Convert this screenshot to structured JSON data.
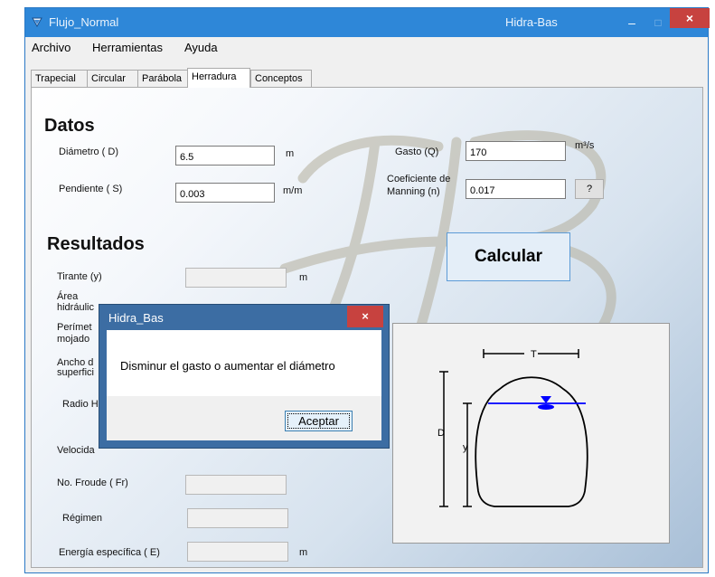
{
  "window": {
    "title": "Flujo_Normal",
    "app_name": "Hidra-Bas",
    "minimize": "–",
    "maximize": "□",
    "close": "×"
  },
  "menu": {
    "items": [
      "Archivo",
      "Herramientas",
      "Ayuda"
    ]
  },
  "tabs": [
    "Trapecial",
    "Circular",
    "Parábola",
    "Herradura",
    "Conceptos"
  ],
  "active_tab": "Herradura",
  "datos": {
    "heading": "Datos",
    "diametro_label": "Diámetro ( D)",
    "diametro_value": "6.5",
    "diametro_unit": "m",
    "pendiente_label": "Pendiente ( S)",
    "pendiente_value": "0.003",
    "pendiente_unit": "m/m",
    "gasto_label": "Gasto (Q)",
    "gasto_value": "170",
    "gasto_unit": "m³/s",
    "manning_label_1": "Coeficiente de",
    "manning_label_2": "Manning (n)",
    "manning_value": "0.017",
    "help_button": "?"
  },
  "calcular_button": "Calcular",
  "resultados": {
    "heading": "Resultados",
    "tirante_label": "Tirante (y)",
    "tirante_unit": "m",
    "area_label_1": "Área",
    "area_label_2": "hidráulic",
    "perimetro_label_1": "Perímet",
    "perimetro_label_2": "mojado",
    "ancho_label_1": "Ancho d",
    "ancho_label_2": "superfici",
    "radio_label": "Radio H",
    "velocidad_label": "Velocida",
    "froude_label": "No. Froude ( Fr)",
    "regimen_label": "Régimen",
    "energia_label": "Energía específica ( E)",
    "energia_unit": "m"
  },
  "diagram": {
    "label_T": "T",
    "label_D": "D",
    "label_y": "y"
  },
  "dialog": {
    "title": "Hidra_Bas",
    "message": "Disminur el gasto o aumentar el diámetro",
    "ok_button": "Aceptar",
    "close": "×"
  },
  "colors": {
    "titlebar": "#2e87d8",
    "dialog_frame": "#3c6da3",
    "close_red": "#c7423f",
    "water_line": "#0000ff"
  },
  "icons": [
    "app-icon",
    "help-icon",
    "close-icon",
    "water-surface-icon"
  ]
}
